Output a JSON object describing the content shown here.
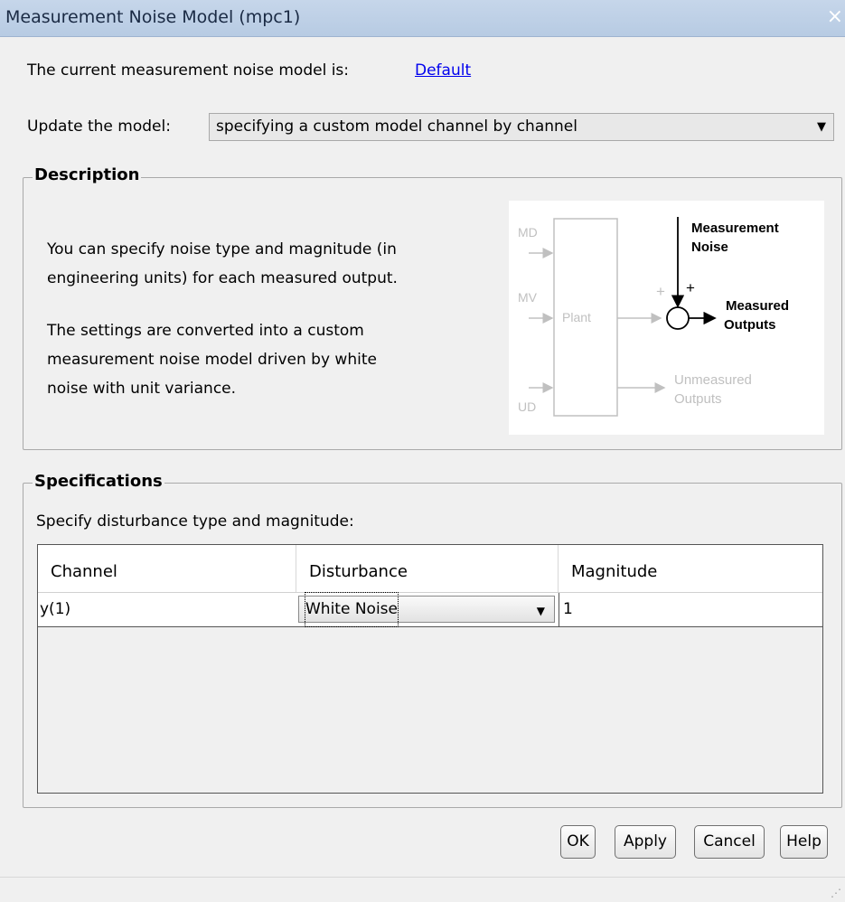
{
  "window": {
    "title": "Measurement Noise Model (mpc1)",
    "close_glyph": "×"
  },
  "current_model": {
    "label": "The current measurement noise model is:",
    "link": "Default"
  },
  "update": {
    "label": "Update the model:",
    "selected": "specifying a custom model channel by channel"
  },
  "description": {
    "legend": "Description",
    "para1_line1": "You can specify noise type and magnitude (in",
    "para1_line2": "engineering units) for each measured output.",
    "para2_line1": "The settings are converted into a custom",
    "para2_line2": "measurement noise model driven by white",
    "para2_line3": "noise with unit variance."
  },
  "diagram": {
    "md": "MD",
    "mv": "MV",
    "ud": "UD",
    "plant": "Plant",
    "plus_grey": "+",
    "plus_black": "+",
    "noise_line1": "Measurement",
    "noise_line2": "Noise",
    "measured_line1": "Measured",
    "measured_line2": "Outputs",
    "unmeasured_line1": "Unmeasured",
    "unmeasured_line2": "Outputs",
    "colors": {
      "grey": "#c0c0c0",
      "black": "#000000"
    }
  },
  "specifications": {
    "legend": "Specifications",
    "instruction": "Specify disturbance type and magnitude:",
    "columns": [
      "Channel",
      "Disturbance",
      "Magnitude"
    ],
    "rows": [
      {
        "channel": "y(1)",
        "disturbance": "White Noise",
        "magnitude": "1"
      }
    ]
  },
  "buttons": {
    "ok": "OK",
    "apply": "Apply",
    "cancel": "Cancel",
    "help": "Help"
  }
}
